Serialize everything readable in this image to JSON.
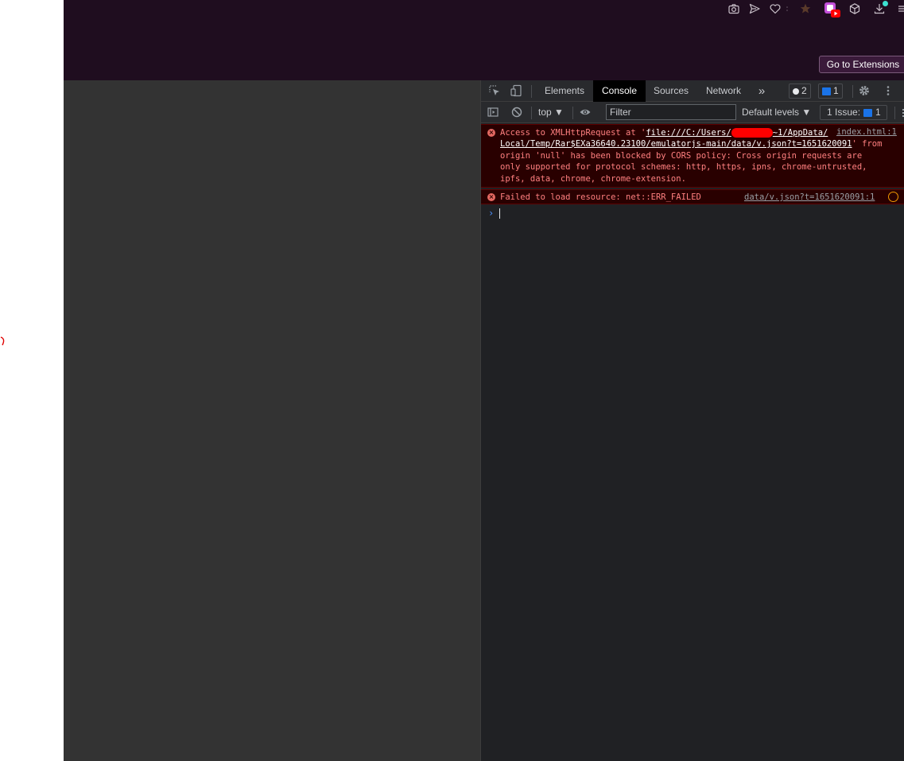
{
  "browser": {
    "go_to_extensions_label": "Go to Extensions",
    "toolbar_icons": [
      "camera-icon",
      "send-icon",
      "heart-icon",
      "star-icon",
      "youtube-extension-icon",
      "cube-icon",
      "download-icon",
      "menu-icon"
    ]
  },
  "devtools": {
    "tabs": [
      "Elements",
      "Console",
      "Sources",
      "Network"
    ],
    "active_tab": "Console",
    "more_tabs_glyph": "»",
    "badge_count_messages": "2",
    "badge_count_info": "1",
    "context": "top ▼",
    "filter_placeholder": "Filter",
    "levels": "Default levels ▼",
    "issues_label": "1 Issue:",
    "issues_count": "1"
  },
  "console": {
    "error1": {
      "text_prefix": "Access to XMLHttpRequest at '",
      "url_part1": "file:///C:/Users/",
      "url_part2": "~1/AppData/",
      "url_line2": "Local/Temp/Rar$EXa36640.23100/emulatorjs-main/data/v.json?t=1651620091",
      "text_after_url": "' from",
      "line3": "origin 'null' has been blocked by CORS policy: Cross origin requests are",
      "line4": "only supported for protocol schemes: http, https, ipns, chrome-untrusted,",
      "line5": "ipfs, data, chrome, chrome-extension.",
      "source": "index.html:1"
    },
    "error2": {
      "text": "Failed to load resource: net::ERR_FAILED",
      "source": "data/v.json?t=1651620091:1"
    },
    "prompt_glyph": "›"
  },
  "colors": {
    "top_bar": "#1f0d1f",
    "page_area": "#333333",
    "devtools_bg": "#202124",
    "error_bg": "#290000",
    "error_text": "#ff8080"
  }
}
